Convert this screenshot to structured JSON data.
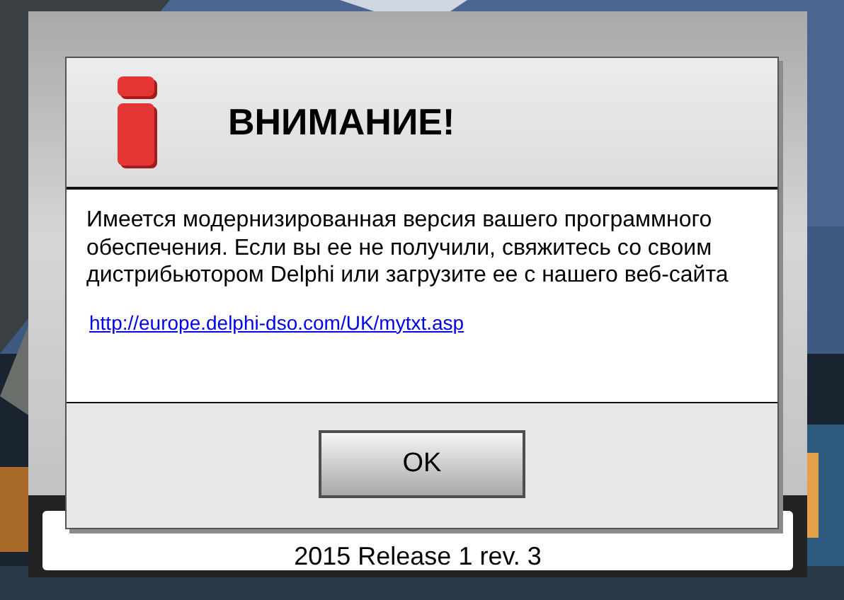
{
  "app": {
    "version": "2015 Release 1 rev. 3"
  },
  "dialog": {
    "title": "ВНИМАНИЕ!",
    "message": "Имеется модернизированная версия вашего программного обеспечения. Если вы ее не получили, свяжитесь со своим дистрибьютором Delphi или загрузите ее с нашего веб-сайта",
    "link": "http://europe.delphi-dso.com/UK/mytxt.asp",
    "buttons": [
      "OK"
    ]
  }
}
